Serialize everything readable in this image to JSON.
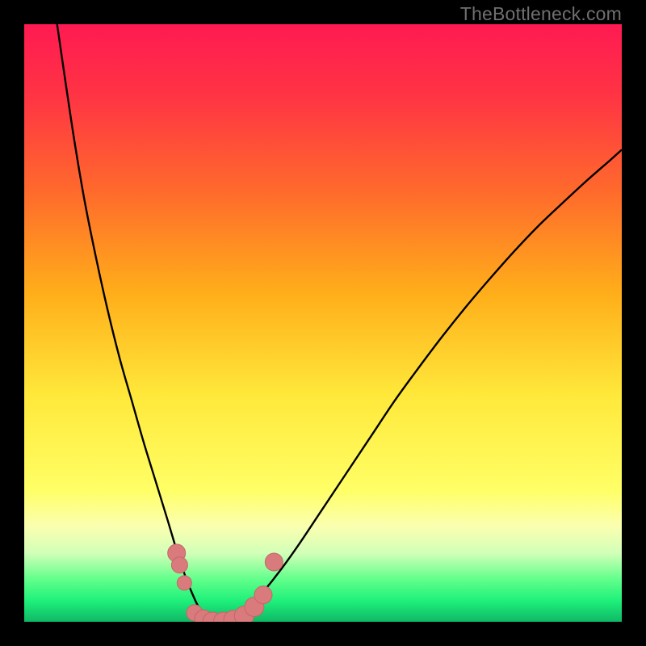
{
  "watermark": "TheBottleneck.com",
  "colors": {
    "frame": "#000000",
    "curve": "#000000",
    "marker_fill": "#d97b7c",
    "marker_stroke": "#c46768",
    "gradient_stops": [
      {
        "offset": 0.0,
        "color": "#ff1a52"
      },
      {
        "offset": 0.12,
        "color": "#ff3444"
      },
      {
        "offset": 0.28,
        "color": "#ff6a2c"
      },
      {
        "offset": 0.45,
        "color": "#ffae1a"
      },
      {
        "offset": 0.62,
        "color": "#ffe83a"
      },
      {
        "offset": 0.78,
        "color": "#ffff66"
      },
      {
        "offset": 0.84,
        "color": "#fbffb0"
      },
      {
        "offset": 0.885,
        "color": "#d2ffb8"
      },
      {
        "offset": 0.93,
        "color": "#5fff8a"
      },
      {
        "offset": 0.965,
        "color": "#1ef07a"
      },
      {
        "offset": 1.0,
        "color": "#0fb866"
      }
    ]
  },
  "chart_data": {
    "type": "line",
    "title": "",
    "xlabel": "",
    "ylabel": "",
    "xlim": [
      0,
      1
    ],
    "ylim": [
      0,
      1
    ],
    "series": [
      {
        "name": "curve",
        "x": [
          0.055,
          0.08,
          0.1,
          0.12,
          0.14,
          0.16,
          0.18,
          0.2,
          0.22,
          0.24,
          0.255,
          0.27,
          0.28,
          0.29,
          0.3,
          0.31,
          0.325,
          0.34,
          0.36,
          0.38,
          0.4,
          0.43,
          0.46,
          0.5,
          0.54,
          0.58,
          0.62,
          0.66,
          0.7,
          0.74,
          0.78,
          0.82,
          0.86,
          0.9,
          0.94,
          0.98,
          1.0
        ],
        "y": [
          1.0,
          0.83,
          0.71,
          0.61,
          0.52,
          0.44,
          0.37,
          0.3,
          0.235,
          0.17,
          0.12,
          0.075,
          0.05,
          0.028,
          0.012,
          0.003,
          0.0,
          0.003,
          0.012,
          0.028,
          0.05,
          0.088,
          0.13,
          0.19,
          0.25,
          0.31,
          0.37,
          0.425,
          0.478,
          0.528,
          0.575,
          0.62,
          0.662,
          0.7,
          0.737,
          0.772,
          0.79
        ]
      }
    ],
    "markers": [
      {
        "x": 0.255,
        "y": 0.115,
        "r": 11
      },
      {
        "x": 0.26,
        "y": 0.095,
        "r": 10
      },
      {
        "x": 0.268,
        "y": 0.065,
        "r": 9
      },
      {
        "x": 0.285,
        "y": 0.015,
        "r": 10
      },
      {
        "x": 0.3,
        "y": 0.005,
        "r": 11
      },
      {
        "x": 0.315,
        "y": 0.0,
        "r": 12
      },
      {
        "x": 0.333,
        "y": 0.0,
        "r": 12
      },
      {
        "x": 0.35,
        "y": 0.003,
        "r": 12
      },
      {
        "x": 0.368,
        "y": 0.01,
        "r": 12
      },
      {
        "x": 0.385,
        "y": 0.025,
        "r": 12
      },
      {
        "x": 0.4,
        "y": 0.045,
        "r": 11
      },
      {
        "x": 0.418,
        "y": 0.1,
        "r": 11
      }
    ]
  }
}
